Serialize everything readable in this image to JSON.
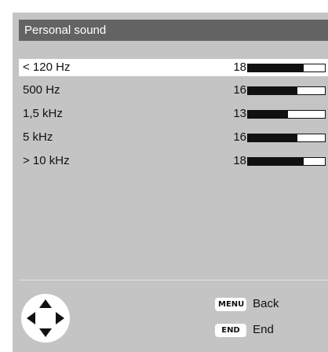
{
  "menu": {
    "title": "Personal sound",
    "max_level": 25,
    "bands": [
      {
        "label": "< 120 Hz",
        "value": "18",
        "level": 18,
        "selected": true
      },
      {
        "label": "500 Hz",
        "value": "16",
        "level": 16,
        "selected": false
      },
      {
        "label": "1,5 kHz",
        "value": "13",
        "level": 13,
        "selected": false
      },
      {
        "label": "5 kHz",
        "value": "16",
        "level": 16,
        "selected": false
      },
      {
        "label": "> 10 kHz",
        "value": "18",
        "level": 18,
        "selected": false
      }
    ]
  },
  "footer": {
    "navigation_icon": "dpad-icon",
    "keys": [
      {
        "badge": "MENU",
        "label": "Back"
      },
      {
        "badge": "END",
        "label": "End"
      }
    ]
  },
  "colors": {
    "panel": "#c4c4c4",
    "title_bar": "#636363",
    "selected_row": "#ffffff",
    "bar_fill": "#111111"
  }
}
